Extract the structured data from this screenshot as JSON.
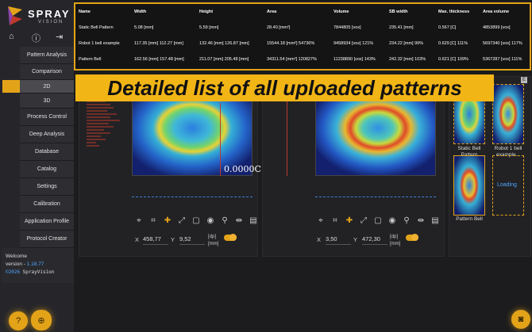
{
  "brand": {
    "name": "SPRAY",
    "sub": "VISION"
  },
  "nav": [
    {
      "label": "Pattern Analysis"
    },
    {
      "label": "Comparison"
    },
    {
      "label": "2D"
    },
    {
      "label": "3D"
    },
    {
      "label": "Process Control"
    },
    {
      "label": "Deep Analysis"
    },
    {
      "label": "Database"
    },
    {
      "label": "Catalog"
    },
    {
      "label": "Settings"
    },
    {
      "label": "Calibration"
    },
    {
      "label": "Application Profile"
    },
    {
      "label": "Protocol Creator"
    }
  ],
  "info": {
    "welcome": "Welcome",
    "version_label": "version - ",
    "version": "1.18.77",
    "year": "©2026",
    "product": " SprayVision"
  },
  "table": {
    "headers": [
      "Name",
      "Width",
      "Height",
      "Area",
      "Volume",
      "SB width",
      "Max. thickness",
      "Area volume"
    ],
    "rows": [
      [
        "Static Bell Pattern",
        "5.08 [mm]",
        "5.59 [mm]",
        "28.40 [mm²]",
        "7844805 [vox]",
        "235.41 [mm]",
        "0.567 [C]",
        "4853899 [vox]"
      ],
      [
        "Robot 1 bell example",
        "117.35 [mm] 112.27 [mm]",
        "132.46 [mm] 126.87 [mm]",
        "15544.18 [mm²] 54736%",
        "9458934 [vox] 121%",
        "234.22 [mm] 99%",
        "0.629 [C] 111%",
        "5697340 [vox] 117%"
      ],
      [
        "Pattern Bell",
        "162.56 [mm] 157.48 [mm]",
        "211.07 [mm] 205.48 [mm]",
        "34311.54 [mm²] 120827%",
        "11238890 [vox] 143%",
        "242.32 [mm] 103%",
        "0.621 [C] 109%",
        "5367287 [vox] 111%"
      ]
    ]
  },
  "banner": "Detailed list of all uploaded patterns",
  "left_view": {
    "readout": "0.0000C",
    "x_label": "X",
    "x_value": "458,77",
    "y_label": "Y",
    "y_value": "9,52",
    "unit1": "[dp]",
    "unit2": "[mm]"
  },
  "right_view": {
    "x_label": "X",
    "x_value": "3,50",
    "y_label": "Y",
    "y_value": "472,30",
    "unit1": "[dp]",
    "unit2": "[mm]"
  },
  "thumbnails": [
    {
      "label": "Static Bell Pattern"
    },
    {
      "label": "Robot 1 bell example..."
    },
    {
      "label": "Pattern Bell"
    },
    {
      "label": "",
      "status": "Loading"
    }
  ],
  "badge": "E",
  "colors": {
    "accent": "#e3a319",
    "link": "#4ea6ff"
  }
}
